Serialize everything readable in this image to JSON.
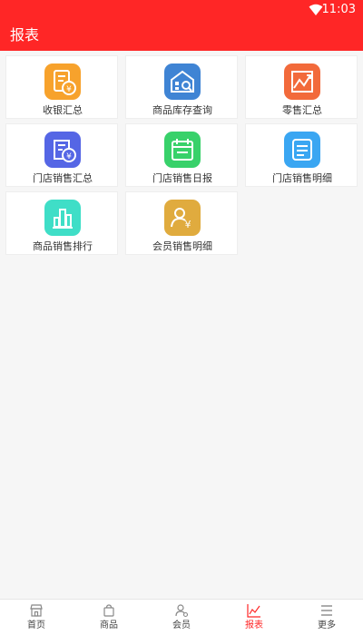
{
  "status": {
    "time": "11:03"
  },
  "header": {
    "title": "报表"
  },
  "tiles": [
    {
      "label": "收银汇总",
      "icon": "cashier-summary-icon",
      "color": "#f7a22c"
    },
    {
      "label": "商品库存查询",
      "icon": "inventory-search-icon",
      "color": "#3f84d4"
    },
    {
      "label": "零售汇总",
      "icon": "retail-trend-icon",
      "color": "#f26a3b"
    },
    {
      "label": "门店销售汇总",
      "icon": "store-sales-summary-icon",
      "color": "#5566e5"
    },
    {
      "label": "门店销售日报",
      "icon": "store-daily-report-icon",
      "color": "#38d16a"
    },
    {
      "label": "门店销售明细",
      "icon": "store-sales-detail-icon",
      "color": "#3aa6f2"
    },
    {
      "label": "商品销售排行",
      "icon": "product-ranking-icon",
      "color": "#3fdec7"
    },
    {
      "label": "会员销售明细",
      "icon": "member-sales-icon",
      "color": "#e0ab3e"
    }
  ],
  "tabs": [
    {
      "label": "首页",
      "icon": "home-store-icon"
    },
    {
      "label": "商品",
      "icon": "bag-icon"
    },
    {
      "label": "会员",
      "icon": "member-icon"
    },
    {
      "label": "报表",
      "icon": "chart-icon",
      "active": true
    },
    {
      "label": "更多",
      "icon": "menu-icon"
    }
  ],
  "accent_color": "#ff2626"
}
